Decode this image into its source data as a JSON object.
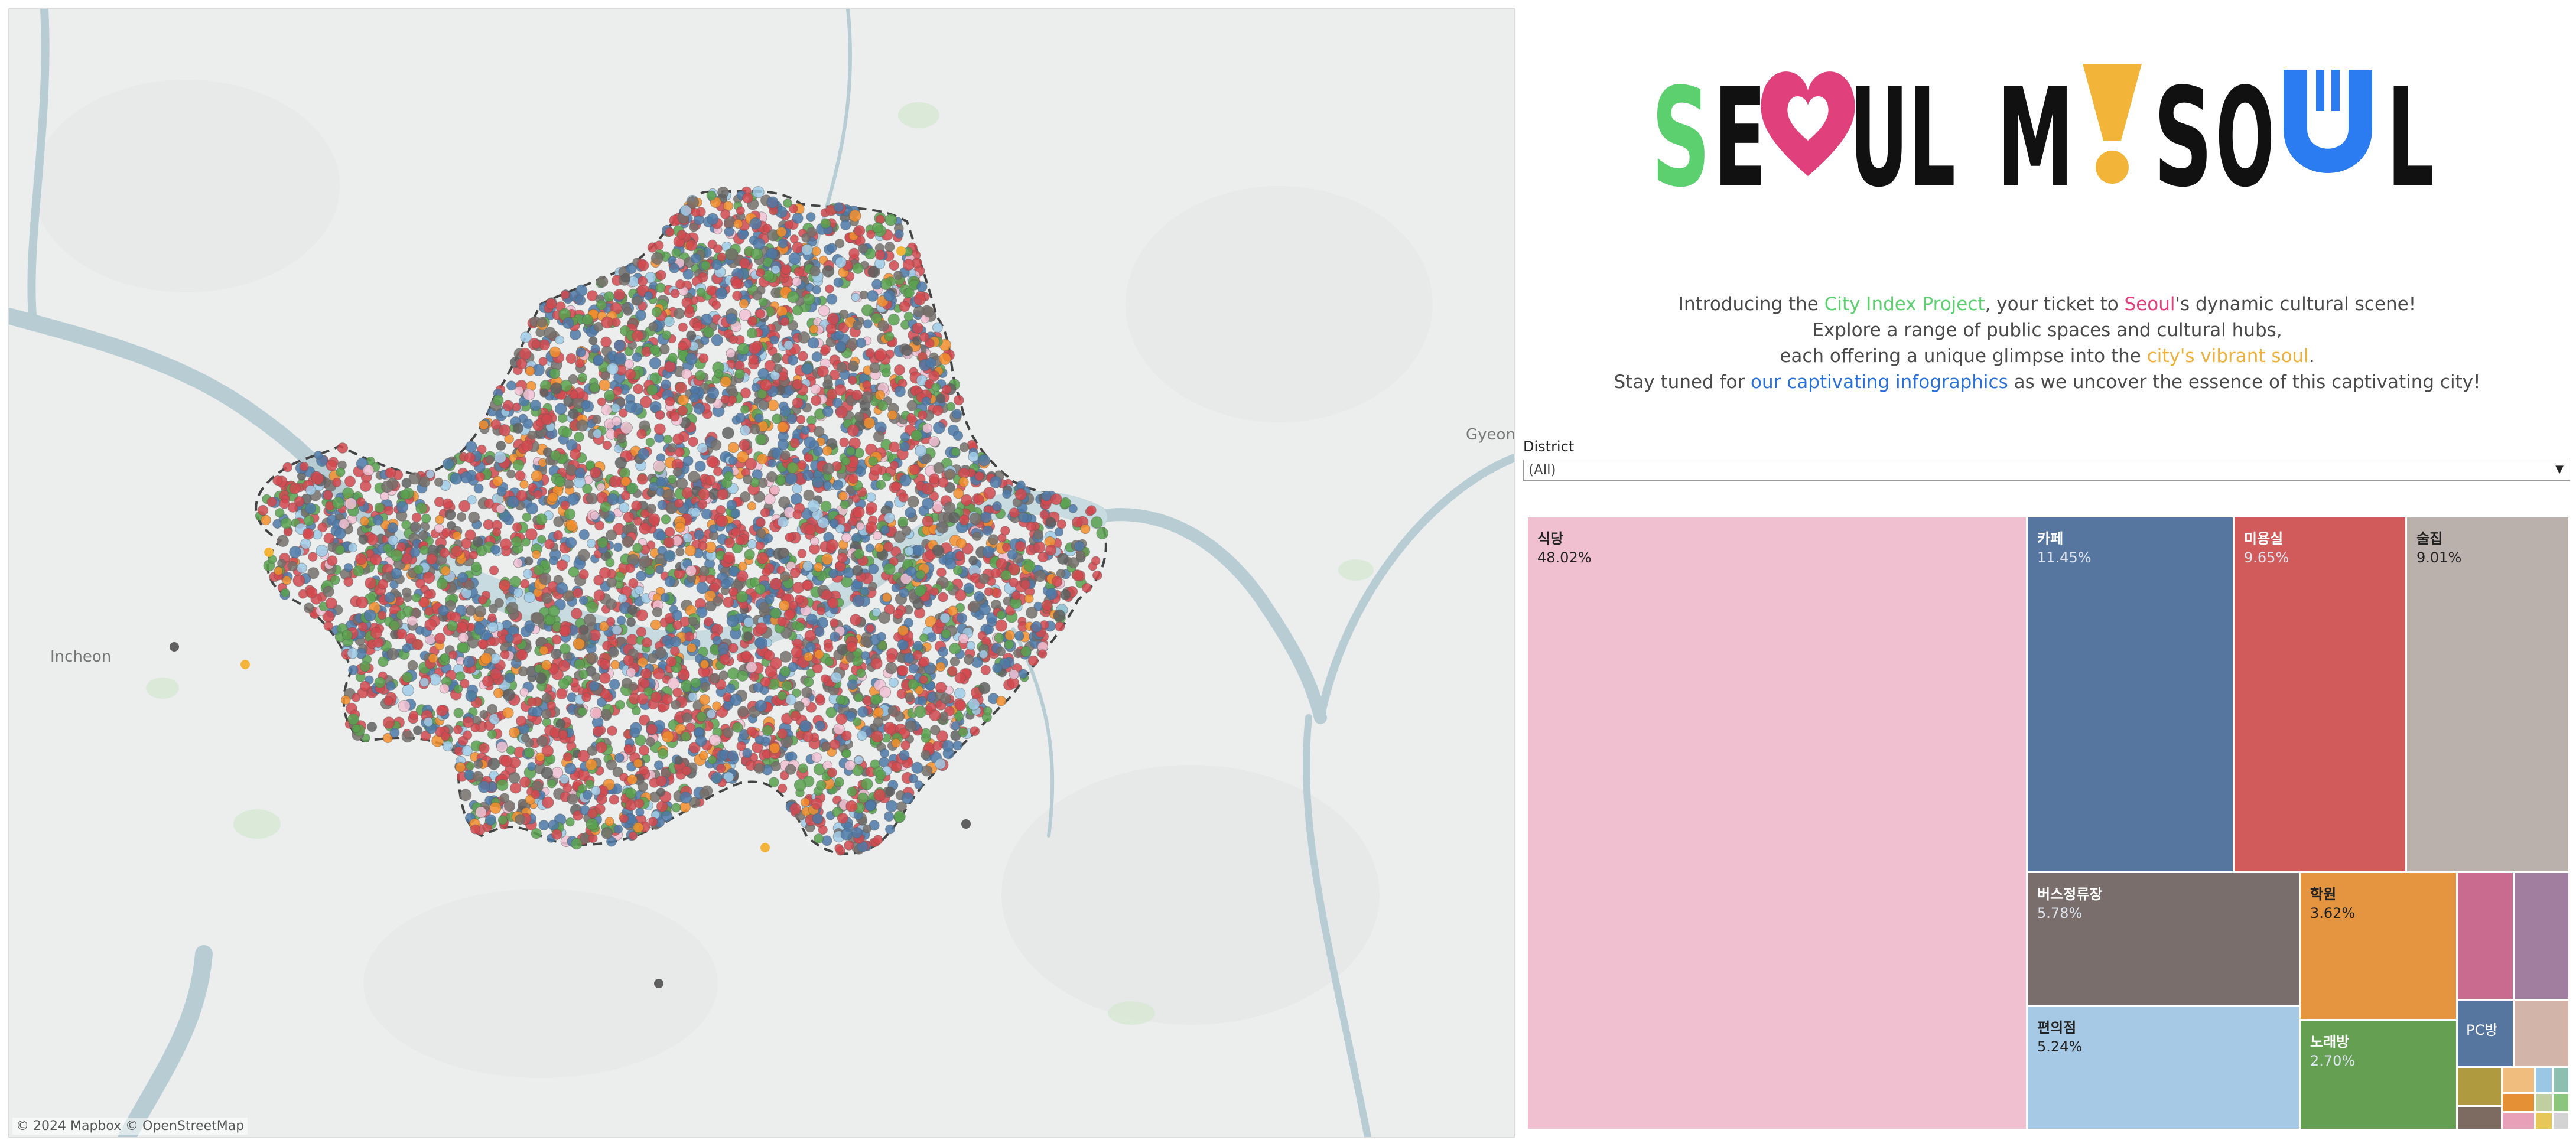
{
  "map": {
    "labels": {
      "gyeonggi": "Gyeon",
      "incheon": "Incheon"
    },
    "attribution": "© 2024 Mapbox  © OpenStreetMap",
    "dot_colors": [
      "#d1494f",
      "#4e79a7",
      "#59a14f",
      "#76706b",
      "#f28e2b",
      "#a0cbe8",
      "#f1c1d2",
      "#606060"
    ]
  },
  "logo": {
    "text": "SEOUL MY SOUL",
    "colors": {
      "green": "#5ccf6f",
      "pink": "#e0407c",
      "yellow": "#f2b53a",
      "blue": "#2a7cf0",
      "black": "#111111"
    }
  },
  "intro": {
    "l1_a": "Introducing the ",
    "l1_b": "City Index Project",
    "l1_c": ", your ticket to ",
    "l1_d": "Seoul",
    "l1_e": "'s dynamic cultural scene!",
    "l2": "Explore a range of public spaces and cultural hubs,",
    "l3_a": "each offering a unique glimpse into the ",
    "l3_b": "city's vibrant soul",
    "l3_c": ".",
    "l4_a": "Stay tuned for ",
    "l4_b": "our captivating infographics",
    "l4_c": " as we uncover the essence of this captivating city!"
  },
  "filter": {
    "label": "District",
    "value": "(All)"
  },
  "treemap": {
    "tiles": [
      {
        "name": "식당",
        "pct": "48.02%",
        "color": "#f1c0d0",
        "dark": false
      },
      {
        "name": "카페",
        "pct": "11.45%",
        "color": "#5676a0",
        "dark": true
      },
      {
        "name": "미용실",
        "pct": "9.65%",
        "color": "#d15a5a",
        "dark": true
      },
      {
        "name": "술집",
        "pct": "9.01%",
        "color": "#bab0ac",
        "dark": false
      },
      {
        "name": "버스정류장",
        "pct": "5.78%",
        "color": "#7a6e6c",
        "dark": true
      },
      {
        "name": "학원",
        "pct": "3.62%",
        "color": "#e59440",
        "dark": false
      },
      {
        "name": "편의점",
        "pct": "5.24%",
        "color": "#a6cae6",
        "dark": false
      },
      {
        "name": "노래방",
        "pct": "2.70%",
        "color": "#649f52",
        "dark": true
      },
      {
        "name": "PC방",
        "pct": "",
        "color": "#5676a0",
        "dark": true
      }
    ],
    "small_colors": [
      "#c86b8f",
      "#a17e9f",
      "#d3b4a8",
      "#b09a40",
      "#f1bd7e",
      "#9ac7e3",
      "#8dbfb1",
      "#7d6b62",
      "#e69036",
      "#e8a0b8",
      "#bfcfa0",
      "#8cc57c",
      "#e6c85a",
      "#d3d3d3"
    ]
  }
}
